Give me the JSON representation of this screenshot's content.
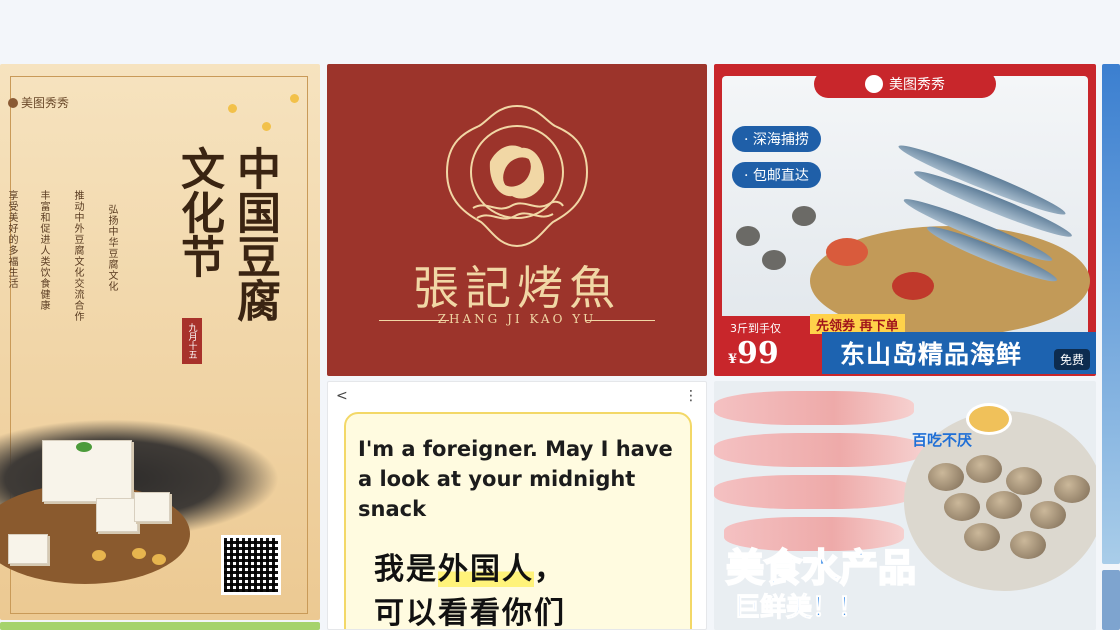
{
  "cards": {
    "tofu": {
      "brand": "美图秀秀",
      "title_right": "中国豆腐",
      "title_left": "文化节",
      "seal": "九月十五",
      "lines": [
        "弘扬中华豆腐文化",
        "推动中外豆腐文化交流合作",
        "丰富和促进人类饮食健康",
        "享受美好的多福生活"
      ]
    },
    "logo": {
      "name": "張記烤魚",
      "pinyin": "ZHANG JI KAO YU"
    },
    "seafood": {
      "brand": "美图秀秀",
      "tags": [
        "· 深海捕捞",
        "· 包邮直达"
      ],
      "price_small": "3斤到手仅",
      "currency": "¥",
      "price": "99",
      "coupon": "先领券 再下单",
      "banner": "东山岛精品海鲜",
      "badge": "免费"
    },
    "foreigner": {
      "back": "<",
      "more": "⋮",
      "en_text": "I'm a foreigner. May I have a look at your midnight snack",
      "zh_line1_a": "我是",
      "zh_line1_b": "外国人",
      "zh_line1_c": "，",
      "zh_line2": "可以看看你们"
    },
    "aquatic": {
      "tag": "百吃不厌",
      "title": "美食水产品",
      "subtitle": "巨鲜美！！"
    }
  }
}
